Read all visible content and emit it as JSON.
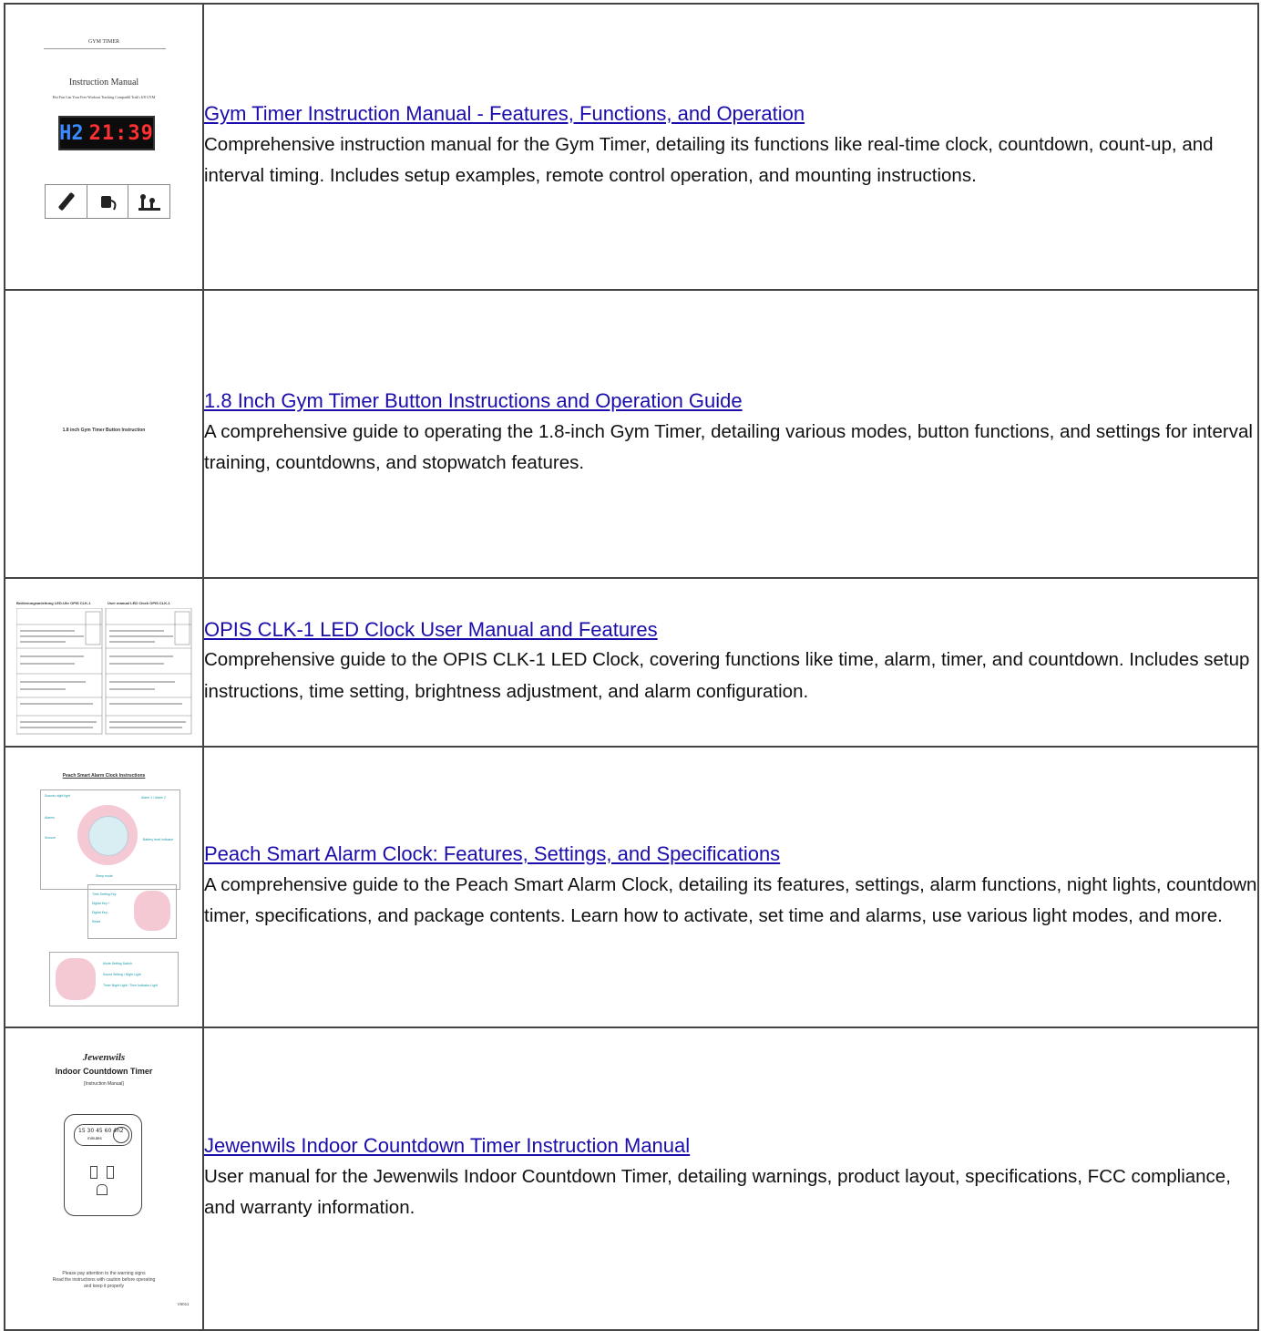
{
  "rows": [
    {
      "title": "Gym Timer Instruction Manual - Features, Functions, and Operation",
      "description": "Comprehensive instruction manual for the Gym Timer, detailing its functions like real-time clock, countdown, count-up, and interval timing. Includes setup examples, remote control operation, and mounting instructions.",
      "thumb": {
        "heading": "GYM TIMER",
        "subheading": "Instruction Manual",
        "tagline": "Hot Fun Can Your Free Workout Tracking Compatibl Trak's 6/8 GYM",
        "display_left": "H2",
        "display_right": "21:39"
      }
    },
    {
      "title": "1.8 Inch Gym Timer Button Instructions and Operation Guide",
      "description": "A comprehensive guide to operating the 1.8-inch Gym Timer, detailing various modes, button functions, and settings for interval training, countdowns, and stopwatch features.",
      "thumb": {
        "heading": "1.8 inch Gym Timer Button Instruction"
      }
    },
    {
      "title": "OPIS CLK-1 LED Clock User Manual and Features",
      "description": "Comprehensive guide to the OPIS CLK-1 LED Clock, covering functions like time, alarm, timer, and countdown. Includes setup instructions, time setting, brightness adjustment, and alarm configuration.",
      "thumb": {
        "left_heading": "Bedienungsanleitung LED-Uhr OPIS CLK-1",
        "right_heading": "User manual LED Clock OPIS CLK-1"
      }
    },
    {
      "title": "Peach Smart Alarm Clock: Features, Settings, and Specifications",
      "description": "A comprehensive guide to the Peach Smart Alarm Clock, detailing its features, settings, alarm functions, night lights, countdown timer, specifications, and package contents. Learn how to activate, set time and alarms, use various light modes, and more.",
      "thumb": {
        "heading": "Peach Smart Alarm Clock Instructions",
        "labels_a": [
          "Sounds night light",
          "Alarm 1 / Alarm 2",
          "Alarms",
          "Snooze",
          "Battery level indicator",
          "Sleep mode"
        ],
        "labels_b": [
          "Time Setting Key",
          "Digital Key +",
          "Digital Key -",
          "Reset"
        ],
        "labels_c": [
          "Mode Setting Switch",
          "Sound Setting / Night Light",
          "Timer Night Light / Time Indicator Light"
        ]
      }
    },
    {
      "title": "Jewenwils Indoor Countdown Timer Instruction Manual",
      "description": "User manual for the Jewenwils Indoor Countdown Timer, detailing warnings, product layout, specifications, FCC compliance, and warranty information.",
      "thumb": {
        "brand": "Jewenwils",
        "heading": "Indoor Countdown Timer",
        "subheading": "[Instruction Manual]",
        "minutes_values": "15 30 45 60 4h2",
        "minutes_label": "minutes",
        "notice": [
          "Please pay attention to the warning signs",
          "Read the instructions with caution before operating",
          "and keep it properly"
        ],
        "code": "V6011"
      }
    }
  ]
}
